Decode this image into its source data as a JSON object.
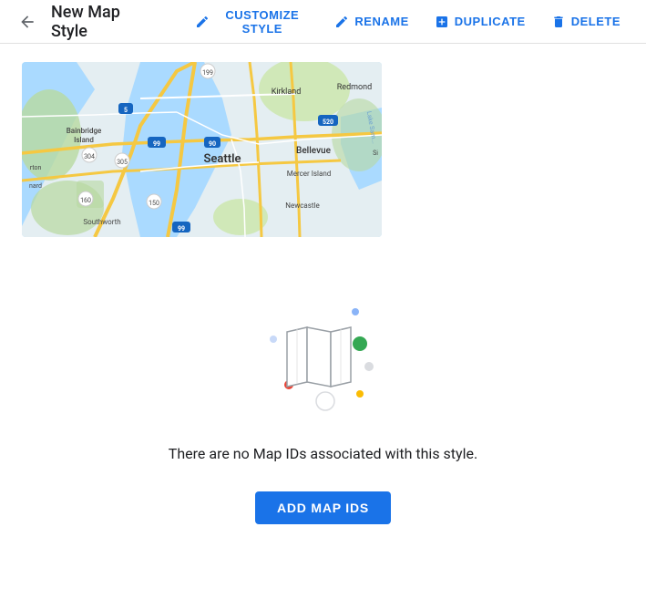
{
  "header": {
    "back_icon": "arrow-left",
    "title": "New Map Style",
    "actions": [
      {
        "id": "customize",
        "label": "CUSTOMIZE STYLE",
        "icon": "pencil-icon"
      },
      {
        "id": "rename",
        "label": "RENAME",
        "icon": "pencil-icon"
      },
      {
        "id": "duplicate",
        "label": "DUPLICATE",
        "icon": "duplicate-icon"
      },
      {
        "id": "delete",
        "label": "DELETE",
        "icon": "trash-icon"
      }
    ]
  },
  "empty_state": {
    "message": "There are no Map IDs associated with this style.",
    "add_button": "ADD MAP IDS"
  },
  "colors": {
    "primary": "#1a73e8",
    "text_primary": "#202124",
    "icon_default": "#5f6368",
    "dot_blue": "#1a73e8",
    "dot_green": "#34a853",
    "dot_red": "#ea4335",
    "dot_yellow": "#fbbc04",
    "dot_light_blue": "#8ab4f8"
  }
}
